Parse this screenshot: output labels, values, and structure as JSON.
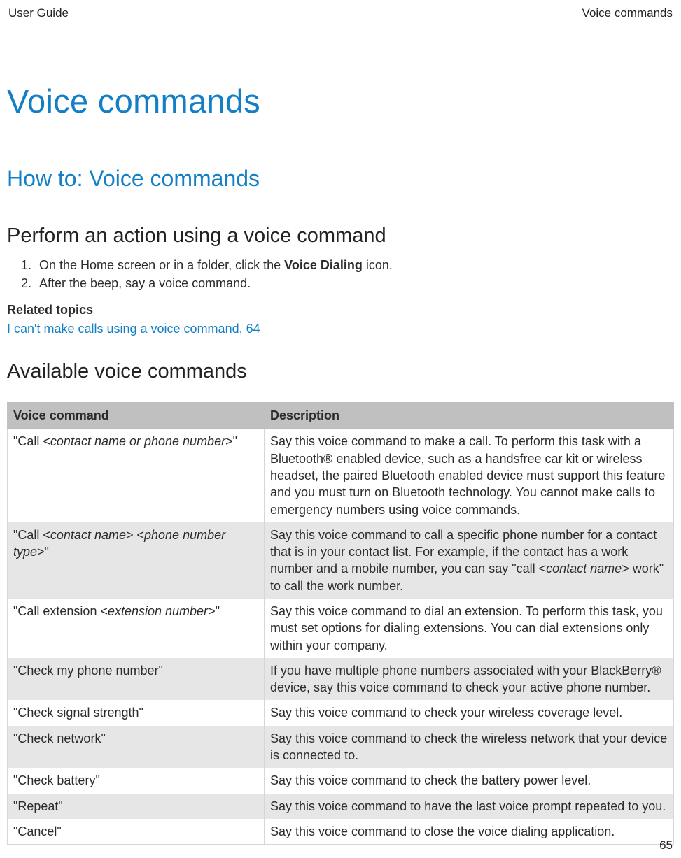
{
  "header": {
    "left": "User Guide",
    "right": "Voice commands"
  },
  "page_number": "65",
  "h1": "Voice commands",
  "h2": "How to: Voice commands",
  "section1": {
    "title": "Perform an action using a voice command",
    "step1_pre": "On the Home screen or in a folder, click the ",
    "step1_bold": "Voice Dialing",
    "step1_post": " icon.",
    "step2": "After the beep, say a voice command."
  },
  "related": {
    "label": "Related topics",
    "link": "I can't make calls using a voice command, 64"
  },
  "section2": {
    "title": "Available voice commands"
  },
  "table": {
    "col1": "Voice command",
    "col2": "Description",
    "rows": [
      {
        "cmd_parts": [
          "\"Call <",
          "contact name or phone number",
          ">\""
        ],
        "desc": "Say this voice command to make a call. To perform this task with a Bluetooth® enabled device, such as a handsfree car kit or wireless headset, the paired Bluetooth enabled device must support this feature and you must turn on Bluetooth technology. You cannot make calls to emergency numbers using voice commands."
      },
      {
        "cmd_parts": [
          "\"Call <",
          "contact name",
          "> <",
          "phone number type",
          ">\""
        ],
        "desc_parts": [
          "Say this voice command to call a specific phone number for a contact that is in your contact list. For example, if the contact has a work number and a mobile number, you can say \"call <",
          "contact name",
          "> work\" to call the work number."
        ]
      },
      {
        "cmd_parts": [
          "\"Call extension <",
          "extension number",
          ">\""
        ],
        "desc": "Say this voice command to dial an extension. To perform this task, you must set options for dialing extensions. You can dial extensions only within your company."
      },
      {
        "cmd_plain": "\"Check my phone number\"",
        "desc": "If you have multiple phone numbers associated with your BlackBerry® device, say this voice command to check your active phone number."
      },
      {
        "cmd_plain": "\"Check signal strength\"",
        "desc": "Say this voice command to check your wireless coverage level."
      },
      {
        "cmd_plain": "\"Check network\"",
        "desc": "Say this voice command to check the wireless network that your device is connected to."
      },
      {
        "cmd_plain": "\"Check battery\"",
        "desc": "Say this voice command to check the battery power level."
      },
      {
        "cmd_plain": "\"Repeat\"",
        "desc": "Say this voice command to have the last voice prompt repeated to you."
      },
      {
        "cmd_plain": "\"Cancel\"",
        "desc": "Say this voice command to close the voice dialing application."
      }
    ]
  }
}
